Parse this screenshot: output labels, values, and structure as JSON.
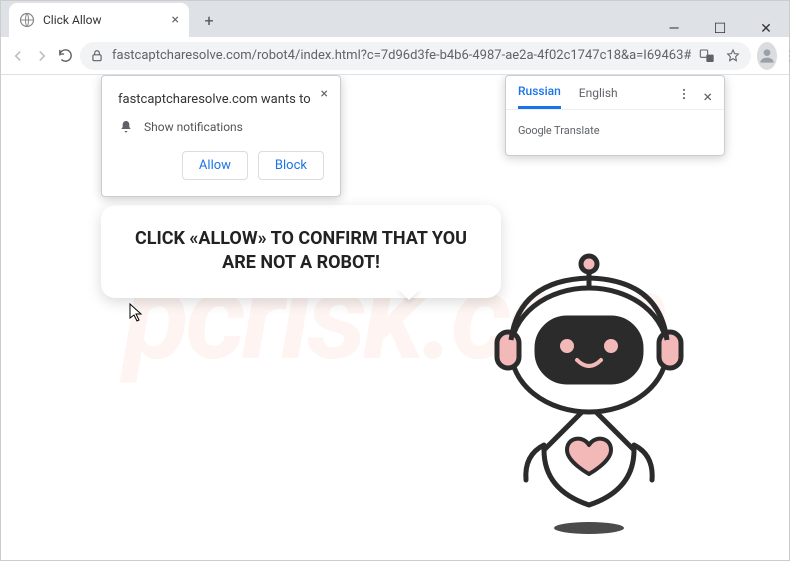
{
  "window": {
    "tab_title": "Click Allow",
    "minimize": "—",
    "maximize": "☐",
    "close": "✕"
  },
  "toolbar": {
    "url": "fastcaptcharesolve.com/robot4/index.html?c=7d96d3fe-b4b6-4987-ae2a-4f02c1747c18&a=I69463#"
  },
  "permission": {
    "title": "fastcaptcharesolve.com wants to",
    "item": "Show notifications",
    "allow": "Allow",
    "block": "Block"
  },
  "translate": {
    "tab_active": "Russian",
    "tab_other": "English",
    "brand": "Google",
    "label": "Translate"
  },
  "bubble": {
    "text": "CLICK «ALLOW» TO CONFIRM THAT YOU ARE NOT A ROBOT!"
  },
  "watermark": {
    "text": "pcrisk.com"
  }
}
